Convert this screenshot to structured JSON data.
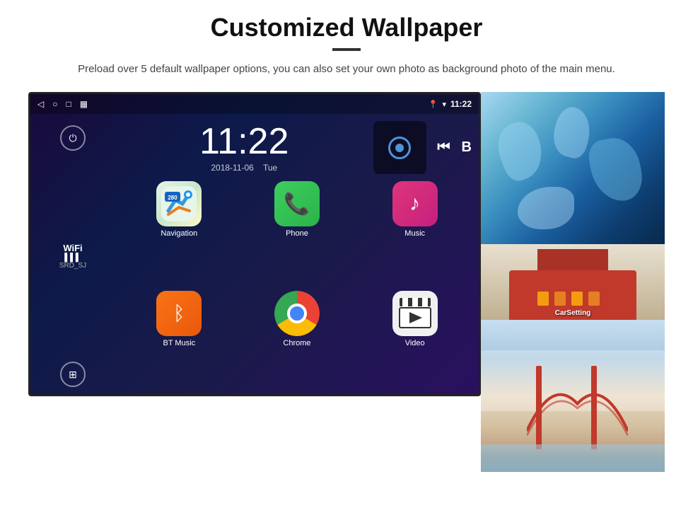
{
  "page": {
    "title": "Customized Wallpaper",
    "subtitle": "Preload over 5 default wallpaper options, you can also set your own photo as background photo of the main menu."
  },
  "statusBar": {
    "time": "11:22",
    "wifi_icon": "wifi",
    "location_icon": "location"
  },
  "clockWidget": {
    "time": "11:22",
    "date": "2018-11-06",
    "day": "Tue"
  },
  "sidebar": {
    "wifi_label": "WiFi",
    "wifi_signal": "▌▌▌",
    "wifi_name": "SRD_SJ"
  },
  "apps": [
    {
      "id": "navigation",
      "label": "Navigation",
      "icon_type": "nav"
    },
    {
      "id": "phone",
      "label": "Phone",
      "icon_type": "phone"
    },
    {
      "id": "music",
      "label": "Music",
      "icon_type": "music"
    },
    {
      "id": "bt-music",
      "label": "BT Music",
      "icon_type": "bt"
    },
    {
      "id": "chrome",
      "label": "Chrome",
      "icon_type": "chrome"
    },
    {
      "id": "video",
      "label": "Video",
      "icon_type": "video"
    }
  ],
  "wallpapers": [
    {
      "id": "ice",
      "label": "Ice Landscape"
    },
    {
      "id": "building",
      "label": "CarSetting"
    },
    {
      "id": "bridge",
      "label": "Golden Gate"
    }
  ]
}
